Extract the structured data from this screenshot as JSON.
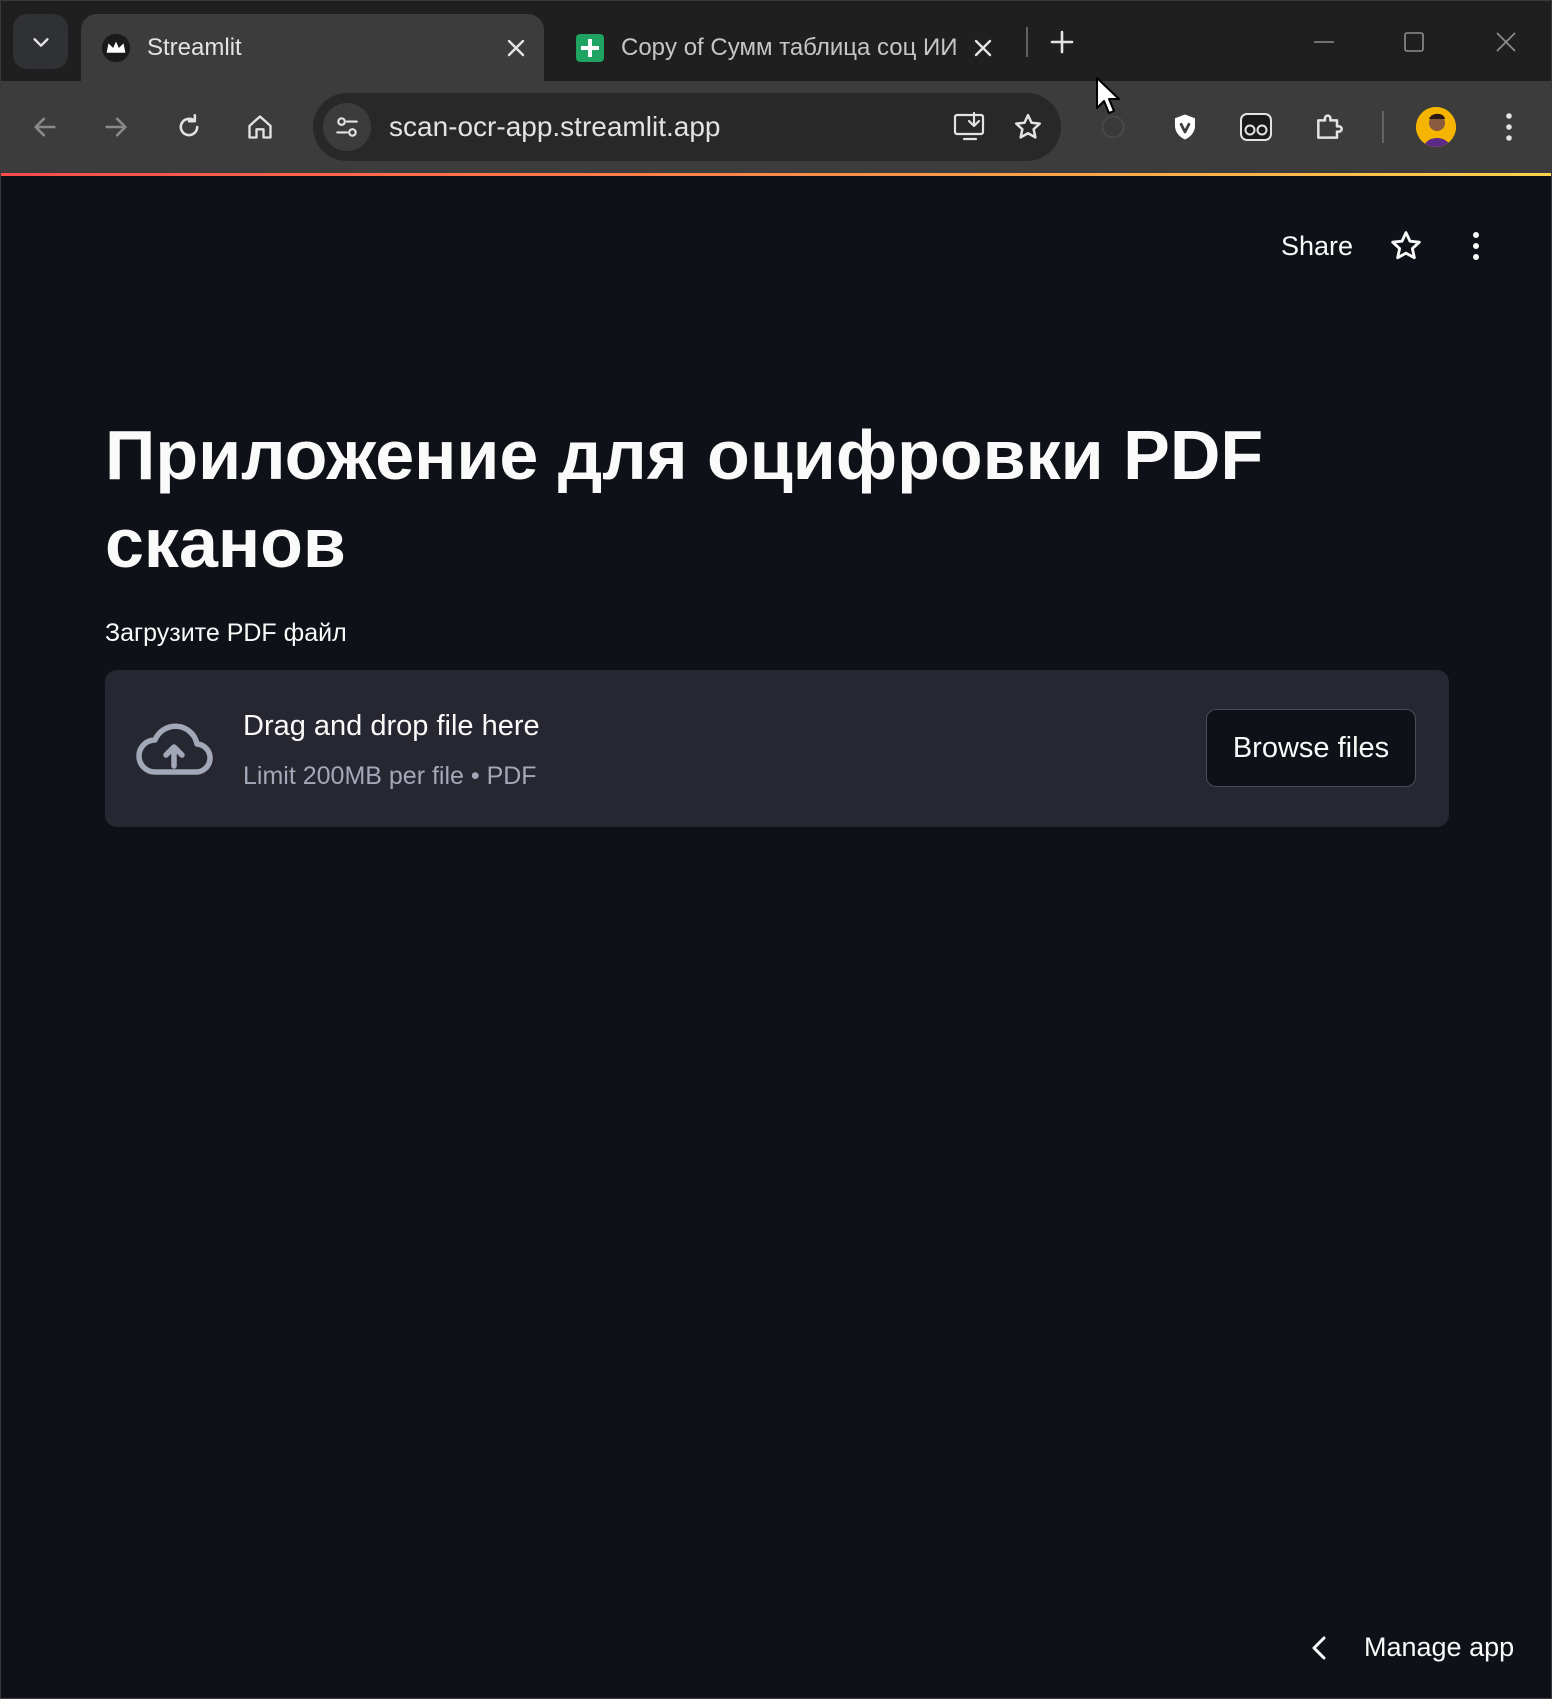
{
  "browser": {
    "tabs": [
      {
        "title": "Streamlit",
        "active": true,
        "favicon": "streamlit-crown-icon"
      },
      {
        "title": "Copy of Сумм таблица соц ИИ",
        "active": false,
        "favicon": "google-sheets-icon"
      }
    ],
    "url": "scan-ocr-app.streamlit.app"
  },
  "header": {
    "share_label": "Share"
  },
  "main": {
    "title": "Приложение для оцифровки PDF сканов",
    "uploader": {
      "label": "Загрузите PDF файл",
      "instruction": "Drag and drop file here",
      "limits": "Limit 200MB per file • PDF",
      "browse_label": "Browse files"
    }
  },
  "footer": {
    "manage_label": "Manage app"
  },
  "colors": {
    "background": "#0e1117",
    "dropzone": "#262730",
    "text": "#fafafa",
    "muted_text": "#a3a8b8",
    "accent": "#ff4b4b"
  }
}
